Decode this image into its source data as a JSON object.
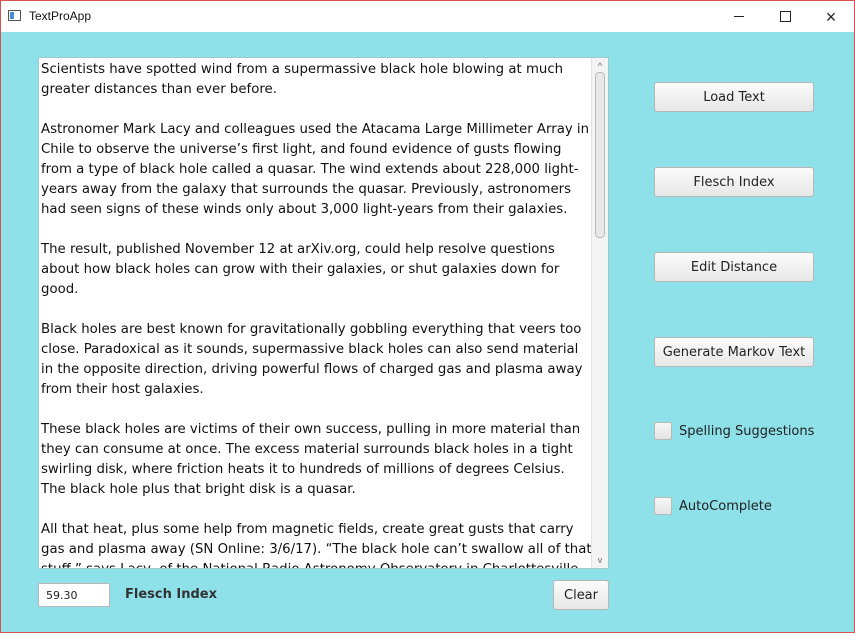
{
  "window": {
    "title": "TextProApp",
    "icon": "app-icon"
  },
  "controls": {
    "minimize_icon": "minimize-icon",
    "maximize_icon": "maximize-icon",
    "close_icon": "close-icon"
  },
  "text_area": {
    "paragraphs": [
      "Scientists have spotted wind from a supermassive black hole blowing at much greater distances than ever before.",
      "Astronomer Mark Lacy and colleagues used the Atacama Large Millimeter Array in Chile to observe the universe’s first light, and found evidence of gusts flowing from a type of black hole called a quasar. The wind extends about 228,000 light-years away from the galaxy that surrounds the quasar. Previously, astronomers had seen signs of these winds only about 3,000 light-years from their galaxies.",
      "The result, published November 12 at arXiv.org, could help resolve questions about how black holes can grow with their galaxies, or shut galaxies down for good.",
      "Black holes are best known for gravitationally gobbling everything that veers too close. Paradoxical as it sounds, supermassive black holes can also send material in the opposite direction, driving powerful flows of charged gas and plasma away from their host galaxies.",
      "These black holes are victims of their own success, pulling in more material than they can consume at once. The excess material surrounds black holes in a tight swirling disk, where friction heats it to hundreds of millions of degrees Celsius. The black hole plus that bright disk is a quasar.",
      "All that heat, plus some help from magnetic fields, create great gusts that carry gas and plasma away (SN Online: 3/6/17). “The black hole can’t swallow all of that stuff,” says Lacy, of the National Radio Astronomy Observatory in Charlottesville, Va. “It has to blow some of it out.”"
    ]
  },
  "buttons": {
    "load_text": "Load Text",
    "flesch_index": "Flesch Index",
    "edit_distance": "Edit Distance",
    "generate_markov": "Generate Markov Text",
    "clear": "Clear"
  },
  "options": {
    "spelling_suggestions": "Spelling Suggestions",
    "autocomplete": "AutoComplete"
  },
  "flesch": {
    "score": "59.30",
    "label": "Flesch Index"
  }
}
